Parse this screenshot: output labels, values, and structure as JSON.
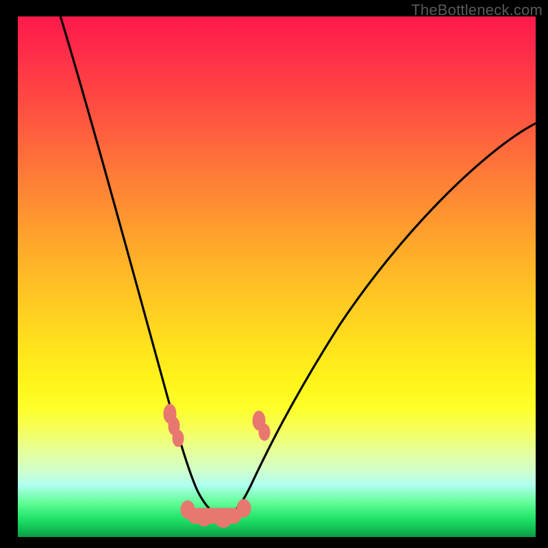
{
  "watermark": "TheBottleneck.com",
  "chart_data": {
    "type": "line",
    "title": "",
    "xlabel": "",
    "ylabel": "",
    "xlim": [
      0,
      100
    ],
    "ylim": [
      0,
      100
    ],
    "grid": false,
    "series": [
      {
        "name": "bottleneck-curve",
        "x": [
          0,
          5,
          10,
          15,
          20,
          25,
          28,
          30,
          32,
          34,
          36,
          38,
          40,
          45,
          50,
          55,
          60,
          65,
          70,
          75,
          80,
          85,
          90,
          95,
          100
        ],
        "y": [
          105,
          94,
          82,
          69,
          55,
          38,
          27,
          18,
          11,
          5,
          2,
          1,
          1,
          4,
          10,
          18,
          26,
          34,
          42,
          49,
          55,
          60,
          65,
          69,
          72
        ]
      }
    ],
    "highlight_band": {
      "region": "green-zone",
      "y_range": [
        0,
        6
      ]
    },
    "markers": [
      {
        "pos": "left-shoulder",
        "x_range": [
          28,
          31
        ],
        "y_range": [
          16,
          24
        ]
      },
      {
        "pos": "right-shoulder",
        "x_range": [
          43,
          48
        ],
        "y_range": [
          16,
          22
        ]
      },
      {
        "pos": "valley-floor",
        "x_range": [
          31,
          43
        ],
        "y_range": [
          2,
          6
        ]
      }
    ]
  }
}
